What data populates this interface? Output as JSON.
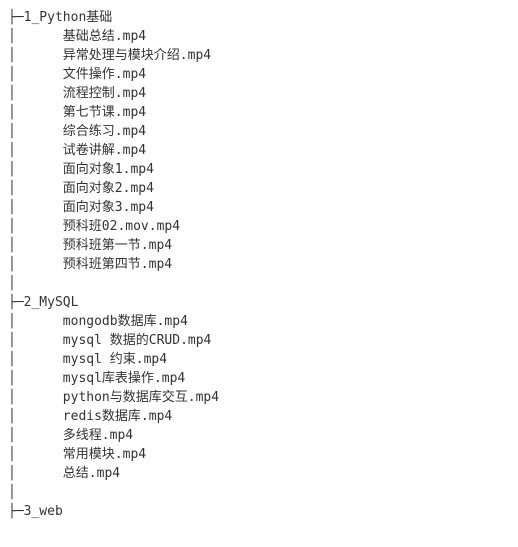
{
  "tree": {
    "folders": [
      {
        "prefix": "├─",
        "name": "1_Python基础",
        "files": [
          "基础总结.mp4",
          "异常处理与模块介绍.mp4",
          "文件操作.mp4",
          "流程控制.mp4",
          "第七节课.mp4",
          "综合练习.mp4",
          "试卷讲解.mp4",
          "面向对象1.mp4",
          "面向对象2.mp4",
          "面向对象3.mp4",
          "预科班02.mov.mp4",
          "预科班第一节.mp4",
          "预科班第四节.mp4"
        ]
      },
      {
        "prefix": "├─",
        "name": "2_MySQL",
        "files": [
          "mongodb数据库.mp4",
          "mysql 数据的CRUD.mp4",
          "mysql 约束.mp4",
          "mysql库表操作.mp4",
          "python与数据库交互.mp4",
          "redis数据库.mp4",
          "多线程.mp4",
          "常用模块.mp4",
          "总结.mp4"
        ]
      },
      {
        "prefix": "├─",
        "name": "3_web",
        "files": []
      }
    ],
    "pipe": "│",
    "file_indent": "│      "
  }
}
